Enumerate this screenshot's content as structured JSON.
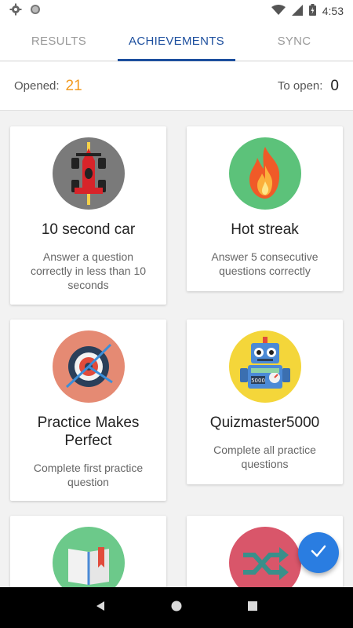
{
  "status_bar": {
    "time": "4:53",
    "icons": [
      "gear-icon",
      "circle-icon",
      "wifi-icon",
      "signal-icon",
      "battery-icon"
    ]
  },
  "tabs": [
    {
      "label": "RESULTS",
      "active": false
    },
    {
      "label": "ACHIEVEMENTS",
      "active": true
    },
    {
      "label": "SYNC",
      "active": false
    }
  ],
  "counts": {
    "opened_label": "Opened:",
    "opened_value": "21",
    "toopen_label": "To open:",
    "toopen_value": "0"
  },
  "achievements": [
    {
      "title": "10 second car",
      "description": "Answer a question correctly in less than 10 seconds",
      "icon": "race-car-icon",
      "badge_color": "#7a7a7a"
    },
    {
      "title": "Hot streak",
      "description": "Answer 5 consecutive questions correctly",
      "icon": "fire-icon",
      "badge_color": "#5cc27a"
    },
    {
      "title": "Practice Makes Perfect",
      "description": "Complete first practice question",
      "icon": "target-icon",
      "badge_color": "#e58a73"
    },
    {
      "title": "Quizmaster5000",
      "description": "Complete all practice questions",
      "icon": "robot-icon",
      "badge_color": "#f4d63a"
    },
    {
      "title": "",
      "description": "",
      "icon": "book-icon",
      "badge_color": "#6cc98a"
    },
    {
      "title": "",
      "description": "",
      "icon": "shuffle-icon",
      "badge_color": "#d9566a"
    }
  ],
  "fab": {
    "icon": "check-icon",
    "color": "#2a7de1"
  },
  "nav_bar": {
    "icons": [
      "back-icon",
      "home-icon",
      "recents-icon"
    ]
  }
}
